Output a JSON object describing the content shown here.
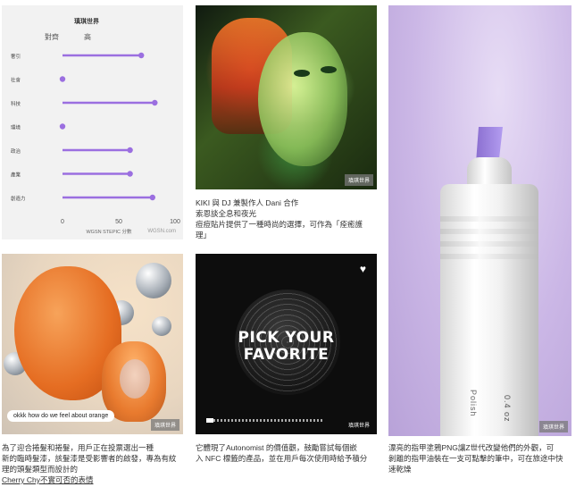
{
  "chart_tile": {
    "watermark": "WGSN.com",
    "chart_data": {
      "type": "lollipop",
      "title": "瑱琪世界",
      "legend": [
        "對齊",
        "高"
      ],
      "categories": [
        "奢引",
        "社會",
        "科技",
        "環境",
        "政治",
        "產業",
        "創造力"
      ],
      "values": [
        70,
        0,
        82,
        0,
        60,
        60,
        80
      ],
      "xlabel": "WGSN STEPIC 分數",
      "xticks": [
        "0",
        "50",
        "100"
      ],
      "xlim": [
        0,
        100
      ],
      "color": "#9b6fe0",
      "grid": false
    }
  },
  "portrait_tile": {
    "watermark": "瑱琪世界",
    "caption": [
      "KIKI 與 DJ 兼製作人 Dani 合作",
      "索恩談全息和夜光",
      "痘痘貼片提供了一種時尚的選擇，可作為「痊癒護",
      "理」"
    ]
  },
  "polish_tile": {
    "watermark": "瑱琪世界",
    "bottle_text_1": "Polish",
    "bottle_text_2": "0.4 oz",
    "caption": [
      "漂亮的指甲塗鴉PNG讓Z世代改變他們的外觀，可",
      "剝離的指甲油裝在一支可點擊的筆中，可在旅途中快",
      "速乾燥"
    ]
  },
  "orange_tile": {
    "watermark": "瑱琪世界",
    "bubble": "okkk how do we feel about orange",
    "caption": [
      "為了迎合捲髮和捲髮，用戶正在投票選出一種",
      "新的臨時髮漆，該髮漆是受影響者的啟發，專為有紋",
      "理的頭髮類型而設計的"
    ],
    "credit": "Cherry Chy不實可否的表情"
  },
  "pick_tile": {
    "title_line1": "PICK YOUR",
    "title_line2": "FAVORITE",
    "heart": "♥",
    "watermark": "瑱琪世界",
    "caption": [
      "它體現了Autonomist 的價值觀，鼓勵嘗試每個嵌",
      "入 NFC 標籤的產品，並在用戶每次使用時給予積分"
    ]
  }
}
